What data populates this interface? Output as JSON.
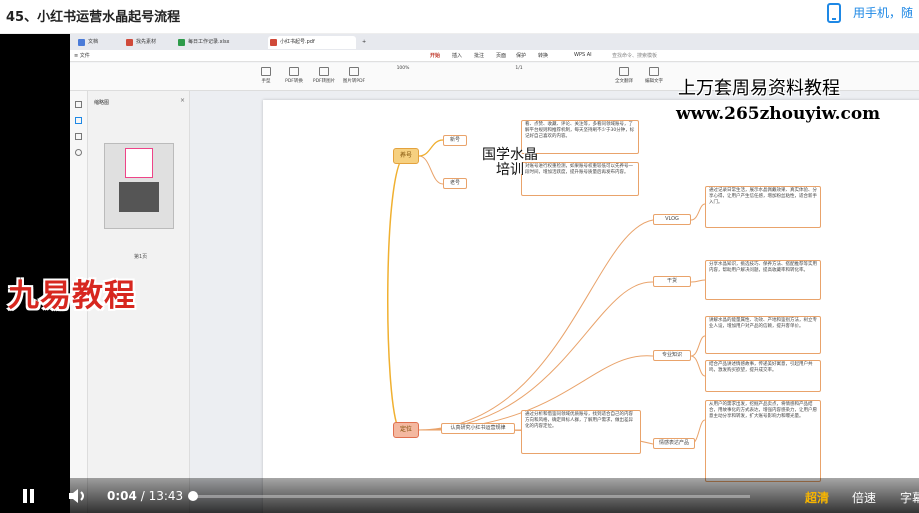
{
  "header": {
    "title": "45、小红书运营水晶起号流程",
    "mobile_link": "用手机，随"
  },
  "app": {
    "tabs": [
      {
        "label": "文档",
        "color": "#4a7bd8"
      },
      {
        "label": "找先素材",
        "color": "#d04a3a"
      },
      {
        "label": "每日工作记录.xlsx",
        "color": "#2e9b4a"
      },
      {
        "label": "小红书起号.pdf",
        "color": "#d04a3a"
      }
    ],
    "tab_add": "+",
    "menu": [
      "≡ 文件",
      "开始",
      "插入",
      "批注",
      "页面",
      "保护",
      "转换",
      "WPS AI",
      "查找命令、搜索模板"
    ],
    "ribbon": [
      "手型",
      "选择",
      "PDF转换",
      "PDF转图片",
      "图片转PDF",
      "全文翻译",
      "编辑文字",
      "编辑图片",
      "删除",
      "朗读"
    ],
    "zoom": "100%",
    "page_num": "1/1",
    "pane_title": "缩略图",
    "pane_close": "×",
    "thumb_label": "第1页"
  },
  "mindmap": {
    "topic1": "养号",
    "topic2": "定位",
    "sub1": "新号",
    "sub2": "老号",
    "sub3": "认真研究小红书运营规律",
    "text1": "看、点赞、收藏、评论、关注等，多看同领域账号，了解平台规则和推荐机制，每天坚持刷不少于30分钟，标记好自己喜欢的内容。",
    "text2": "对账号进行权重检测，如果账号权重较低可以先养号一段时间，增加活跃度，提升账号质量后再发布内容。",
    "text3": "通过分析和借鉴同领域优质账号，找到适合自己的内容方向和风格，确定目标人群，了解用户需求，做出差异化的内容定位。",
    "vlog": "VLOG",
    "tutorial": "干货",
    "pro": "专业知识",
    "products": "情感表达产品",
    "v1": "通过记录日常生活，展示水晶佩戴效果、真实体验、分享心得，让用户产生信任感，增加粉丝粘性，适合新手入门。",
    "v2": "分享水晶知识，挑选技巧、保养方法、搭配推荐等实用内容，帮助用户解决问题，提高收藏率和转化率。",
    "v3": "讲解水晶的能量属性、功效、产地和鉴别方法，树立专业人设，增加用户对产品的信赖，提升客单价。",
    "v4": "结合产品讲述情感故事，传递美好寓意，引起用户共鸣，激发购买欲望，提升成交率。",
    "v5": "从用户的需求出发，挖掘产品卖点，将情感和产品结合，用故事化的方式表达，增强内容感染力，让用户愿意主动分享和转发，扩大账号影响力和曝光量。"
  },
  "watermarks": {
    "w1": "上万套周易资料教程",
    "w2": "www.265zhouyiw.com",
    "w3a": "国学水晶",
    "w3b": "培训",
    "logo": "九易教程"
  },
  "player": {
    "current": "0:04",
    "separator": "/",
    "duration": "13:43",
    "progress": 0.005,
    "quality": "超清",
    "speed": "倍速",
    "subtitle": "字幕"
  }
}
